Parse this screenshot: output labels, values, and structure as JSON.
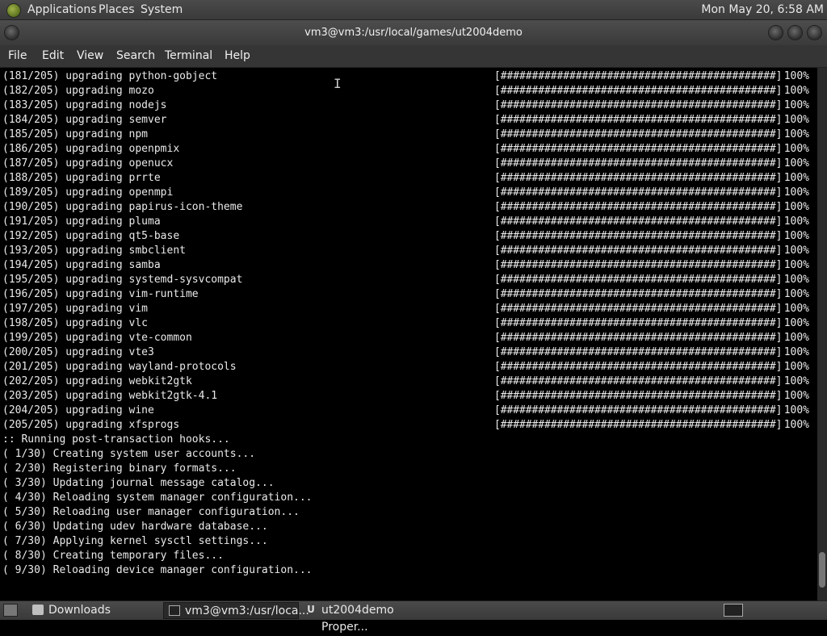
{
  "top_panel": {
    "menus": [
      "Applications",
      "Places",
      "System"
    ],
    "clock": "Mon May 20,  6:58 AM"
  },
  "window": {
    "title": "vm3@vm3:/usr/local/games/ut2004demo"
  },
  "menubar": [
    "File",
    "Edit",
    "View",
    "Search",
    "Terminal",
    "Help"
  ],
  "terminal": {
    "upgrades": [
      {
        "text": "(181/205) upgrading python-gobject"
      },
      {
        "text": "(182/205) upgrading mozo"
      },
      {
        "text": "(183/205) upgrading nodejs"
      },
      {
        "text": "(184/205) upgrading semver"
      },
      {
        "text": "(185/205) upgrading npm"
      },
      {
        "text": "(186/205) upgrading openpmix"
      },
      {
        "text": "(187/205) upgrading openucx"
      },
      {
        "text": "(188/205) upgrading prrte"
      },
      {
        "text": "(189/205) upgrading openmpi"
      },
      {
        "text": "(190/205) upgrading papirus-icon-theme"
      },
      {
        "text": "(191/205) upgrading pluma"
      },
      {
        "text": "(192/205) upgrading qt5-base"
      },
      {
        "text": "(193/205) upgrading smbclient"
      },
      {
        "text": "(194/205) upgrading samba"
      },
      {
        "text": "(195/205) upgrading systemd-sysvcompat"
      },
      {
        "text": "(196/205) upgrading vim-runtime"
      },
      {
        "text": "(197/205) upgrading vim"
      },
      {
        "text": "(198/205) upgrading vlc"
      },
      {
        "text": "(199/205) upgrading vte-common"
      },
      {
        "text": "(200/205) upgrading vte3"
      },
      {
        "text": "(201/205) upgrading wayland-protocols"
      },
      {
        "text": "(202/205) upgrading webkit2gtk"
      },
      {
        "text": "(203/205) upgrading webkit2gtk-4.1"
      },
      {
        "text": "(204/205) upgrading wine"
      },
      {
        "text": "(205/205) upgrading xfsprogs"
      }
    ],
    "progress_bar": "[############################################]",
    "progress_percent": "100%",
    "hooks": [
      ":: Running post-transaction hooks...",
      "( 1/30) Creating system user accounts...",
      "( 2/30) Registering binary formats...",
      "( 3/30) Updating journal message catalog...",
      "( 4/30) Reloading system manager configuration...",
      "( 5/30) Reloading user manager configuration...",
      "( 6/30) Updating udev hardware database...",
      "( 7/30) Applying kernel sysctl settings...",
      "( 8/30) Creating temporary files...",
      "( 9/30) Reloading device manager configuration..."
    ]
  },
  "taskbar": {
    "tasks": [
      {
        "label": "Downloads",
        "icon": "folder-icon"
      },
      {
        "label": "vm3@vm3:/usr/loca...",
        "icon": "terminal-icon"
      },
      {
        "label": "ut2004demo Proper...",
        "icon": "ut-icon"
      }
    ],
    "ut_icon_glyph": "U"
  }
}
